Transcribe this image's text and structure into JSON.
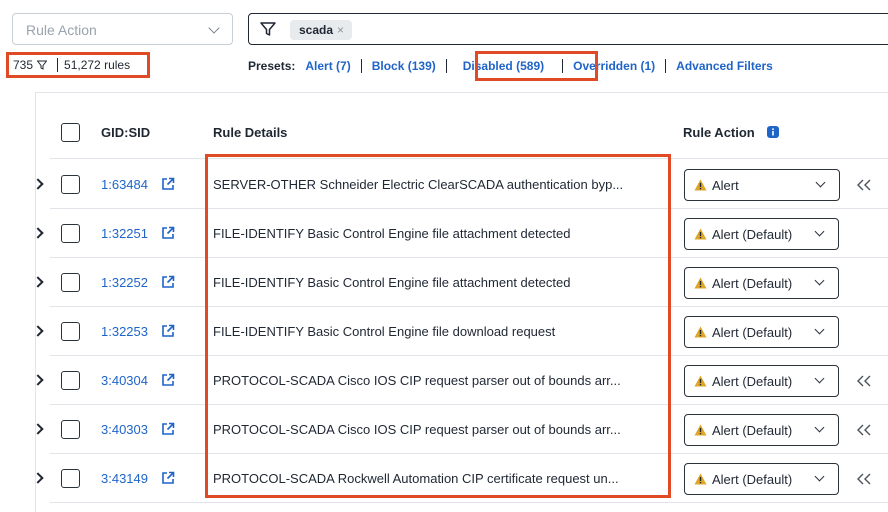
{
  "filters": {
    "rule_action_placeholder": "Rule Action",
    "search_chip": "scada",
    "chip_close": "×"
  },
  "counts": {
    "filtered": "735",
    "total": "51,272 rules"
  },
  "presets": {
    "label": "Presets:",
    "alert": "Alert (7)",
    "block": "Block (139)",
    "disabled": "Disabled (589)",
    "overridden": "Overridden (1)",
    "advanced": "Advanced Filters"
  },
  "table": {
    "headers": {
      "gid_sid": "GID:SID",
      "rule_details": "Rule Details",
      "rule_action": "Rule Action"
    },
    "rows": [
      {
        "gid": "1:63484",
        "details": "SERVER-OTHER Schneider Electric ClearSCADA authentication byp...",
        "action": "Alert",
        "overridden": true
      },
      {
        "gid": "1:32251",
        "details": "FILE-IDENTIFY Basic Control Engine file attachment detected",
        "action": "Alert (Default)",
        "overridden": false
      },
      {
        "gid": "1:32252",
        "details": "FILE-IDENTIFY Basic Control Engine file attachment detected",
        "action": "Alert (Default)",
        "overridden": false
      },
      {
        "gid": "1:32253",
        "details": "FILE-IDENTIFY Basic Control Engine file download request",
        "action": "Alert (Default)",
        "overridden": false
      },
      {
        "gid": "3:40304",
        "details": "PROTOCOL-SCADA Cisco IOS CIP request parser out of bounds arr...",
        "action": "Alert (Default)",
        "overridden": true
      },
      {
        "gid": "3:40303",
        "details": "PROTOCOL-SCADA Cisco IOS CIP request parser out of bounds arr...",
        "action": "Alert (Default)",
        "overridden": true
      },
      {
        "gid": "3:43149",
        "details": "PROTOCOL-SCADA Rockwell Automation CIP certificate request un...",
        "action": "Alert (Default)",
        "overridden": true
      }
    ]
  },
  "colors": {
    "highlight": "#e04a25",
    "link": "#1f64c8",
    "warning": "#e0a526",
    "info": "#1f64c8"
  },
  "icons": [
    "filter-icon",
    "funnel-icon",
    "chevron-down-icon",
    "external-link-icon",
    "warning-icon",
    "info-icon",
    "double-chevron-icon",
    "expand-icon"
  ]
}
